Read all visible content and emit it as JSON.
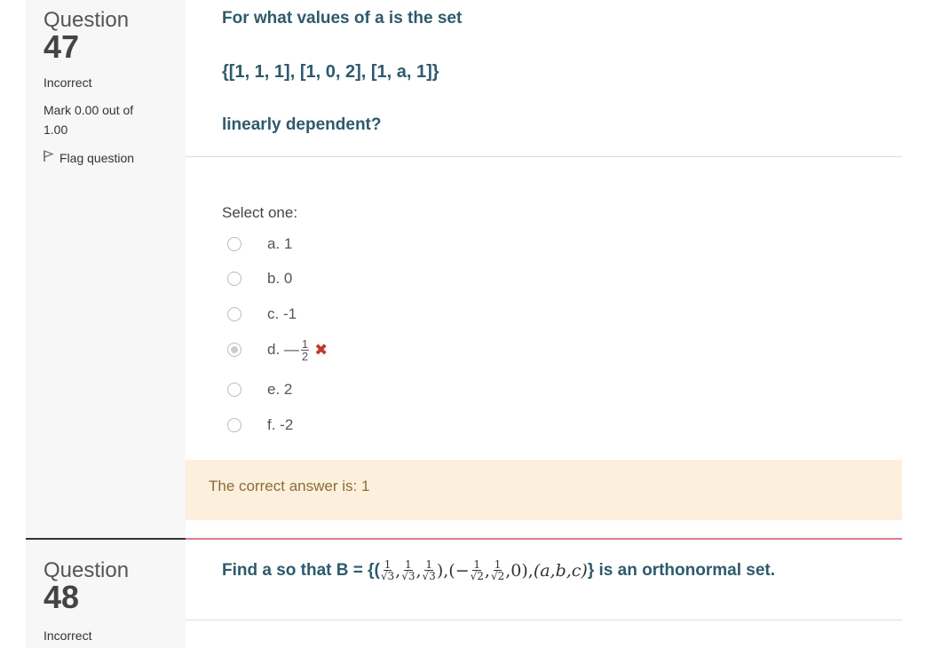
{
  "q47": {
    "label": "Question",
    "number": "47",
    "state": "Incorrect",
    "mark_line1": "Mark 0.00 out of",
    "mark_line2": "1.00",
    "flag": "Flag question",
    "text_line1": "For what values of a is the set",
    "text_line2": "{[1, 1, 1], [1, 0, 2], [1, a, 1]}",
    "text_line3": "linearly dependent?",
    "prompt": "Select one:",
    "options": [
      {
        "label": "a. 1",
        "checked": false
      },
      {
        "label": "b. 0",
        "checked": false
      },
      {
        "label": "c. -1",
        "checked": false
      },
      {
        "label": "d. —",
        "frac_num": "1",
        "frac_den": "2",
        "checked": true,
        "incorrect_mark": "✖"
      },
      {
        "label": "e. 2",
        "checked": false
      },
      {
        "label": "f. -2",
        "checked": false
      }
    ],
    "feedback": "The correct answer is: 1"
  },
  "q48": {
    "label": "Question",
    "number": "48",
    "state": "Incorrect",
    "text_prefix": "Find a so that B = {(",
    "text_suffix": "} is an orthonormal set.",
    "math": {
      "frac_num": "1",
      "den_sqrt3": "√3",
      "den_sqrt2": "√2",
      "neg": "−",
      "zero": "0",
      "abc": "(a,b,c)"
    }
  },
  "colors": {
    "question_text": "#2e5a6d",
    "info_bg": "#f7f7f7",
    "feedback_bg": "#fcefdc",
    "incorrect": "#c0392b",
    "divider_accent": "#e07b8f"
  }
}
